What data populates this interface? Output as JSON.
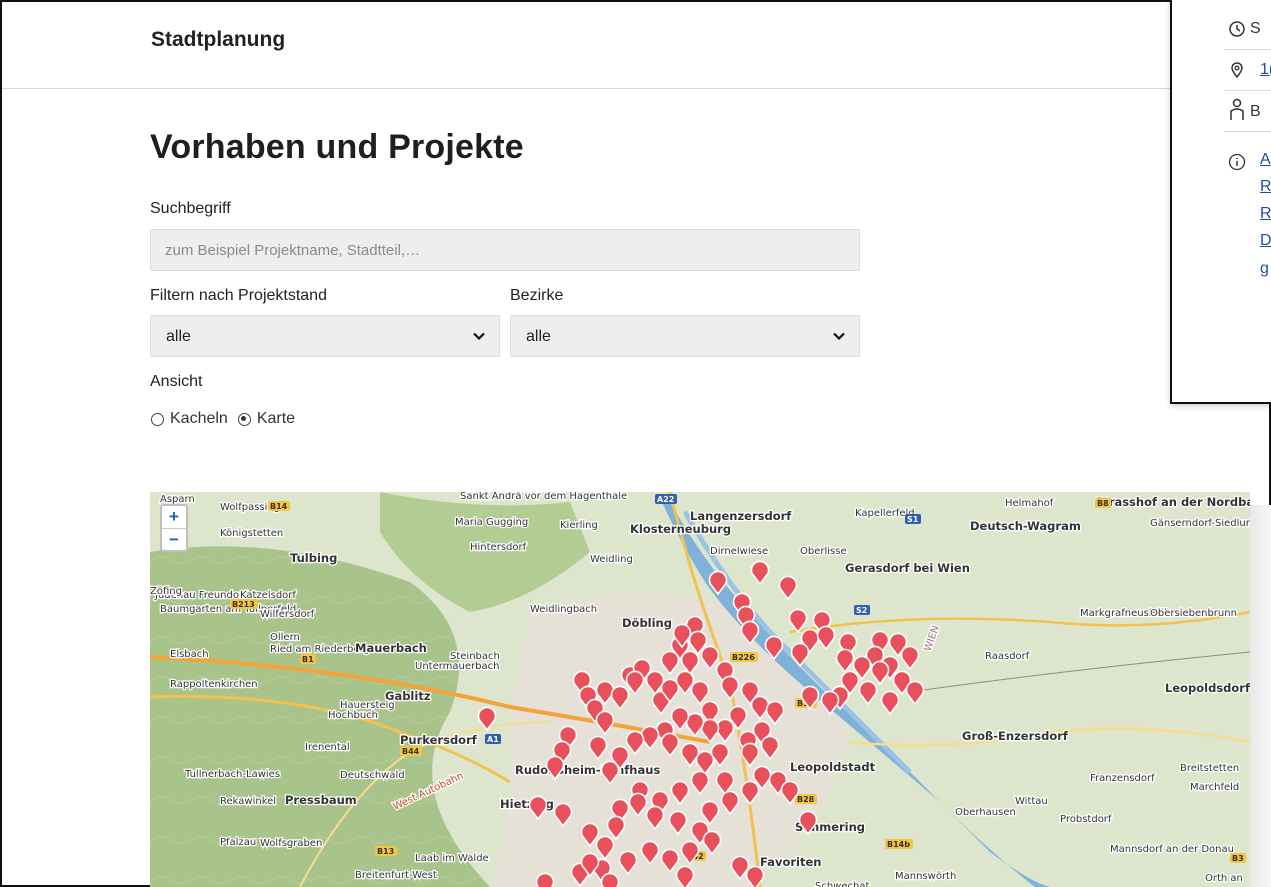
{
  "header": {
    "site_title": "Stadtplanung"
  },
  "main": {
    "title": "Vorhaben und Projekte",
    "search": {
      "label": "Suchbegriff",
      "placeholder": "zum Beispiel Projektname, Stadtteil,…",
      "value": ""
    },
    "filter_status": {
      "label": "Filtern nach Projektstand",
      "value": "alle"
    },
    "filter_district": {
      "label": "Bezirke",
      "value": "alle"
    },
    "view": {
      "label": "Ansicht",
      "options": [
        "Kacheln",
        "Karte"
      ],
      "selected": "Karte"
    }
  },
  "map": {
    "zoom_in": "+",
    "zoom_out": "−",
    "place_labels": [
      "Asparn",
      "Wolfpassing",
      "Sankt Andrä vor dem Hagenthale",
      "Langenzersdorf",
      "Kapellerfeld",
      "Helmahof",
      "Strasshof an der Nordbahn",
      "Klosterneuburg",
      "Kierling",
      "Maria Gugging",
      "Königstetten",
      "Hintersdorf",
      "Deutsch-Wagram",
      "Gänserndorf-Siedlung",
      "Tulbing",
      "Weidling",
      "Dirnelwiese",
      "Oberlisse",
      "Gerasdorf bei Wien",
      "Judenau Freundorf",
      "Katzelsdorf",
      "Baumgarten am Tullnerfeld",
      "Wilfersdorf",
      "Zöfing",
      "Ollern",
      "Weidlingbach",
      "Döbling",
      "Markgrafneusiedl",
      "Obersiebenbrunn",
      "Ried am Riederberg",
      "Mauerbach",
      "Elsbach",
      "Steinbach",
      "Raasdorf",
      "Rappoltenkirchen",
      "Untermauerbach",
      "Gablitz",
      "Hauersteig",
      "Hochbuch",
      "Leopoldsdorf im Marchfelde",
      "Irenental",
      "Purkersdorf",
      "Groß-Enzersdorf",
      "Tullnerbach-Lawies",
      "Deutschwald",
      "Rudolfsheim-Fünfhaus",
      "Leopoldstadt",
      "Franzensdorf",
      "Breitstetten",
      "Pressbaum",
      "Rekawinkel",
      "Hietzing",
      "Wittau",
      "Oberhausen",
      "Marchfeld",
      "Probstdorf",
      "Simmering",
      "Pfalzau",
      "Wolfsgraben",
      "Laab im Walde",
      "Mannsdorf an der Donau",
      "Favoriten",
      "Breitenfurt-West",
      "Mannswörth",
      "Schwechat",
      "Orth an",
      "West Autobahn",
      "WIEN"
    ],
    "road_labels": [
      "B14",
      "A22",
      "S1",
      "B8",
      "B213",
      "B1",
      "A1",
      "B44",
      "B13",
      "B226",
      "B3b",
      "S2",
      "B14b",
      "B3",
      "B28",
      "B2"
    ],
    "marker_color": "#e8505b"
  },
  "popup": {
    "rows": [
      "S",
      "1(",
      "B",
      "A",
      "R",
      "R",
      "D",
      "g"
    ]
  }
}
